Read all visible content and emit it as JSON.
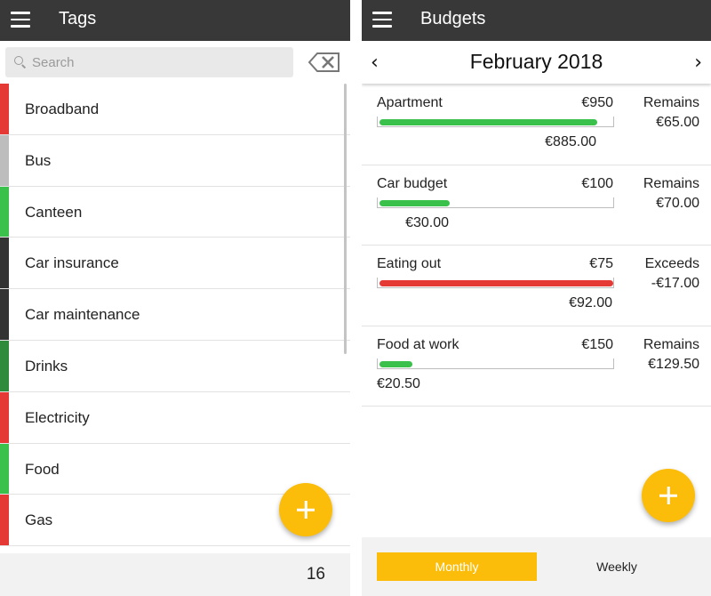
{
  "tags_screen": {
    "title": "Tags",
    "search": {
      "placeholder": "Search"
    },
    "tags": [
      {
        "name": "Broadband",
        "color": "#e53935"
      },
      {
        "name": "Bus",
        "color": "#bdbdbd"
      },
      {
        "name": "Canteen",
        "color": "#3ac14c"
      },
      {
        "name": "Car insurance",
        "color": "#333333"
      },
      {
        "name": "Car maintenance",
        "color": "#333333"
      },
      {
        "name": "Drinks",
        "color": "#2e8b3c"
      },
      {
        "name": "Electricity",
        "color": "#e53935"
      },
      {
        "name": "Food",
        "color": "#3ac14c"
      },
      {
        "name": "Gas",
        "color": "#e53935"
      }
    ],
    "count": "16",
    "icons": {
      "menu": "hamburger-icon",
      "search": "search-icon",
      "clear": "backspace-icon",
      "add": "plus-icon"
    },
    "accent": "#fbbd0a"
  },
  "budgets_screen": {
    "title": "Budgets",
    "month": "February 2018",
    "prev_label": "‹",
    "next_label": "›",
    "budgets": [
      {
        "name": "Apartment",
        "amount": "€950",
        "spent": "€885.00",
        "status": "Remains",
        "remaining": "€65.00",
        "progress": 0.93,
        "color": "#3ac14c"
      },
      {
        "name": "Car budget",
        "amount": "€100",
        "spent": "€30.00",
        "status": "Remains",
        "remaining": "€70.00",
        "progress": 0.3,
        "color": "#3ac14c"
      },
      {
        "name": "Eating out",
        "amount": "€75",
        "spent": "€92.00",
        "status": "Exceeds",
        "remaining": "-€17.00",
        "progress": 1.0,
        "color": "#e53935"
      },
      {
        "name": "Food at work",
        "amount": "€150",
        "spent": "€20.50",
        "status": "Remains",
        "remaining": "€129.50",
        "progress": 0.14,
        "color": "#3ac14c"
      }
    ],
    "period_tabs": [
      {
        "label": "Monthly",
        "selected": true
      },
      {
        "label": "Weekly",
        "selected": false
      }
    ],
    "accent": "#fbbd0a"
  }
}
